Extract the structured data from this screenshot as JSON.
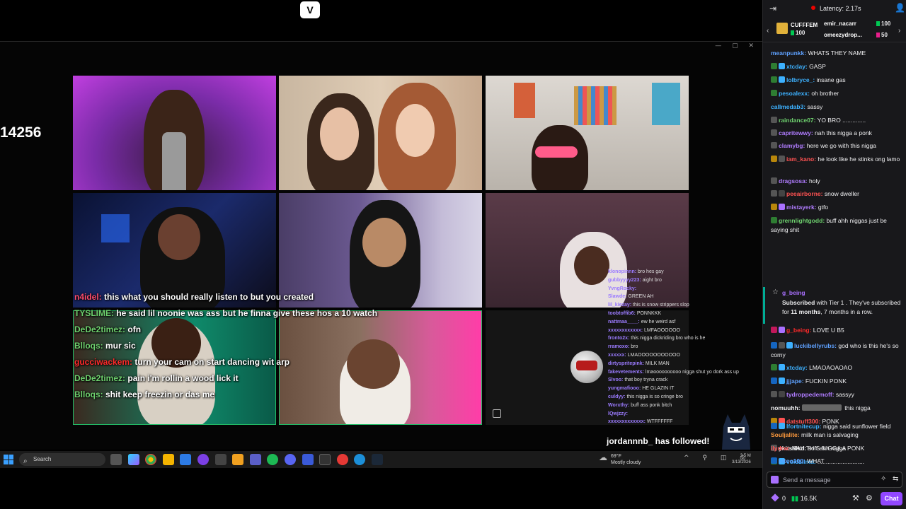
{
  "stream": {
    "logo_text": "V",
    "counter": "14256",
    "overlay_chat": [
      {
        "user": "n4idel:",
        "text": " this what you should really listen to but you created",
        "color": "#ff4d6d"
      },
      {
        "user": "TYSLIME:",
        "text": " he said lil noonie was ass but he finna give these hos a 10 watch",
        "color": "#6ed16e"
      },
      {
        "user": "DeDe2timez:",
        "text": " ofn",
        "color": "#6ed16e"
      },
      {
        "user": "Blloqs:",
        "text": " mur sic",
        "color": "#6ed16e"
      },
      {
        "user": "gucciwackem:",
        "text": " turn your cam on start dancing wit arp",
        "color": "#ff2a2a"
      },
      {
        "user": "DeDe2timez:",
        "text": " pain i'm rollin a wood lick it",
        "color": "#6ed16e"
      },
      {
        "user": "Blloqs:",
        "text": " shit keep freezin or das me",
        "color": "#6ed16e"
      }
    ],
    "mini_chat": [
      {
        "user": "klonopinnn:",
        "text": " bro hes gay"
      },
      {
        "user": "gubbyyyy223:",
        "text": " aight bro"
      },
      {
        "user": "YvngRocky:",
        "text": ""
      },
      {
        "user": "Slawde:",
        "text": " GREEN AH"
      },
      {
        "user": "lil_kiezay:",
        "text": " this is snow strippers slop"
      },
      {
        "user": "toobtoffib6:",
        "text": " PONNKKK"
      },
      {
        "user": "nattmaa____:",
        "text": " ew he weird asf"
      },
      {
        "user": "xxxxxxxxxxxx:",
        "text": " LMFAOOOOOO"
      },
      {
        "user": "fronto2x:",
        "text": " this nigga dickriding bro who is he"
      },
      {
        "user": "rramoxo:",
        "text": " bro"
      },
      {
        "user": "xxxxxx:",
        "text": " LMAOOOOOOOOOOO"
      },
      {
        "user": "dirtyspritepink:",
        "text": " MILK MAN"
      },
      {
        "user": "fakevetements:",
        "text": " lmaoooooooooo nigga shut yo dork ass up"
      },
      {
        "user": "Slvoo:",
        "text": " that boy tryna crack"
      },
      {
        "user": "yungmafiooo:",
        "text": " HE GLAZIN IT"
      },
      {
        "user": "culdyy:",
        "text": " this nigga is so cringe bro"
      },
      {
        "user": "Worxthy:",
        "text": " buff ass ponk bitch"
      },
      {
        "user": "lQwjzzy:",
        "text": ""
      },
      {
        "user": "xxxxxxxxxxxxx:",
        "text": " WTFFFFFF"
      }
    ],
    "followed": "jordannnb_ has followed!",
    "colors": {
      "accent": "#9147ff",
      "live_red": "#eb0400"
    }
  },
  "taskbar": {
    "search_placeholder": "Search",
    "weather_temp": "69°F",
    "weather_desc": "Mostly cloudy",
    "clock_time": "3:5 M",
    "clock_date": "3/13/2026"
  },
  "chat": {
    "latency": "Latency: 2.17s",
    "leaderboard": {
      "top_name": "CUFFFEM",
      "top_value": "100",
      "rows": [
        {
          "name": "emir_nacarr",
          "value": "100"
        },
        {
          "name": "omeezydrop...",
          "value": "50"
        }
      ]
    },
    "messages": [
      {
        "user": "meanpunkk:",
        "text": " WHATS THEY NAME",
        "color": "#5ea1ff",
        "badge": ""
      },
      {
        "user": "xtcday:",
        "text": " GASP",
        "color": "#3db1ff",
        "badge": "#2e7d32"
      },
      {
        "user": "lolbryce_:",
        "text": " insane gas",
        "color": "#3db1ff",
        "badge": "#2e7d32"
      },
      {
        "user": "pesoalexx:",
        "text": " oh brother",
        "color": "#3db1ff",
        "badge": "#2e7d32"
      },
      {
        "user": "callmedab3:",
        "text": " sassy",
        "color": "#3db1ff",
        "badge": ""
      },
      {
        "user": "raindance07:",
        "text": " YO BRO ..............",
        "color": "#6ed16e",
        "badge": "#555"
      },
      {
        "user": "capritewwy:",
        "text": " nah this nigga a ponk",
        "color": "#b07cff",
        "badge": "#555"
      },
      {
        "user": "clamybg:",
        "text": " here we go with this nigga",
        "color": "#b07cff",
        "badge": "#555"
      },
      {
        "user": "iam_kano:",
        "text": " he look like he stinks ong lamo",
        "color": "#ff5252",
        "badge": "#b8860b"
      },
      {
        "user": "dragsosa:",
        "text": " holy",
        "color": "#b07cff",
        "badge": "#555"
      },
      {
        "user": "peeairborne:",
        "text": " snow dweller",
        "color": "#ff5252",
        "badge": "#555"
      },
      {
        "user": "mistayerk:",
        "text": " gtfo",
        "color": "#b07cff",
        "badge": "#b8860b"
      },
      {
        "user": "grennlightgodd:",
        "text": " buff ahh niggas just be saying shit",
        "color": "#6ed16e",
        "badge": "#2e7d32"
      },
      {
        "user": "g_being:",
        "text": " LOVE U B5",
        "color": "#ff2a2a",
        "badge": "#c2185b"
      },
      {
        "user": "luckibellyrubs:",
        "text": " god who is this he's so corny",
        "color": "#5ea1ff",
        "badge": "#1565c0"
      },
      {
        "user": "xtcday:",
        "text": " LMAOAOAOAO",
        "color": "#3db1ff",
        "badge": "#2e7d32"
      },
      {
        "user": "jjjape:",
        "text": " FUCKIN PONK",
        "color": "#5ea1ff",
        "badge": "#1565c0"
      },
      {
        "user": "tydroppedemoff:",
        "text": " sassyy",
        "color": "#b07cff",
        "badge": "#555"
      },
      {
        "user": "nomuuhh:",
        "text": " this nigga",
        "color": "#efeff1",
        "badge": ""
      },
      {
        "user": "datstuff300:",
        "text": " PONK",
        "color": "#ff5252",
        "badge": "#b8860b"
      },
      {
        "user": "Souljalite:",
        "text": " milk man is salvaging",
        "color": "#ff9a3d",
        "badge": ""
      },
      {
        "user": "ykitslilkd:",
        "text": " soft ahh nigga",
        "color": "#efeff1",
        "badge": "#555"
      },
      {
        "user": "voidziima:",
        "text": " ............................",
        "color": "#3db1ff",
        "badge": "#2e7d32"
      },
      {
        "user": "lfortnitecup:",
        "text": " nigga said sunflower field",
        "color": "#3db1ff",
        "badge": "#1565c0"
      },
      {
        "user": "ilydrw:",
        "text": " NAH THIS NIGGA A PONK",
        "color": "#ff5252",
        "badge": ""
      },
      {
        "user": "vttoo100:",
        "text": " WHAT",
        "color": "#5ea1ff",
        "badge": "#1565c0"
      }
    ],
    "subscription": {
      "user": "g_being",
      "text_pre": "Subscribed",
      "text": " with Tier 1 . They've subscribed for ",
      "months": "11 months",
      "text_post": ", 7 months in a row."
    },
    "send_placeholder": "Send a message",
    "points": "0",
    "bits": "16.5K",
    "chat_button": "Chat"
  }
}
